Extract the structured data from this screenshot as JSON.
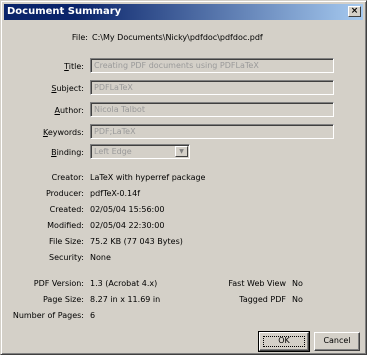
{
  "window": {
    "title": "Document Summary",
    "close_glyph": "×"
  },
  "file": {
    "label": "File:",
    "value": "C:\\My Documents\\Nicky\\pdfdoc\\pdfdoc.pdf"
  },
  "fields": {
    "title": {
      "label_u": "T",
      "label_rest": "itle:",
      "value": "Creating PDF documents using PDFLaTeX"
    },
    "subject": {
      "label_u": "S",
      "label_rest": "ubject:",
      "value": "PDFLaTeX"
    },
    "author": {
      "label_u": "A",
      "label_rest": "uthor:",
      "value": "Nicola Talbot"
    },
    "keywords": {
      "label_u": "K",
      "label_rest": "eywords:",
      "value": "PDF;LaTeX"
    },
    "binding": {
      "label_u": "B",
      "label_rest": "inding:",
      "value": "Left Edge",
      "arrow": "▼"
    }
  },
  "info": [
    {
      "label": "Creator:",
      "value": "LaTeX with hyperref package"
    },
    {
      "label": "Producer:",
      "value": "pdfTeX-0.14f"
    },
    {
      "label": "Created:",
      "value": "02/05/04 15:56:00"
    },
    {
      "label": "Modified:",
      "value": "02/05/04 22:30:00"
    },
    {
      "label": "File Size:",
      "value": "75.2 KB (77 043 Bytes)"
    },
    {
      "label": "Security:",
      "value": "None"
    }
  ],
  "pdf": {
    "version_label": "PDF Version:",
    "version_value": "1.3 (Acrobat 4.x)",
    "pagesize_label": "Page Size:",
    "pagesize_value": "8.27 in x 11.69 in",
    "pages_label": "Number of Pages:",
    "pages_value": "6",
    "fastweb_label": "Fast Web View",
    "fastweb_value": "No",
    "tagged_label": "Tagged PDF",
    "tagged_value": "No"
  },
  "buttons": {
    "ok": "OK",
    "cancel": "Cancel"
  }
}
